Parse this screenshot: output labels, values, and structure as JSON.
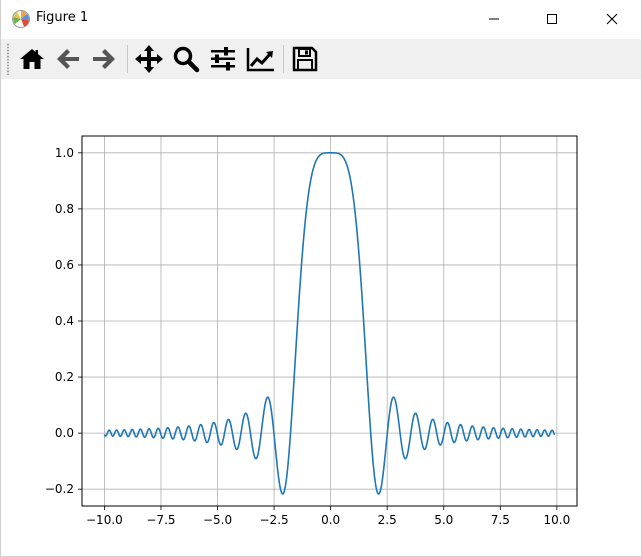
{
  "window": {
    "title": "Figure 1",
    "controls": {
      "minimize": "minimize",
      "maximize": "maximize",
      "close": "close"
    }
  },
  "toolbar": {
    "items": [
      {
        "name": "home",
        "icon": "home-icon"
      },
      {
        "name": "back",
        "icon": "arrow-left-icon"
      },
      {
        "name": "forward",
        "icon": "arrow-right-icon"
      },
      {
        "name": "pan",
        "icon": "move-icon"
      },
      {
        "name": "zoom",
        "icon": "magnifier-icon"
      },
      {
        "name": "subplots",
        "icon": "sliders-icon"
      },
      {
        "name": "edit-axes",
        "icon": "chart-line-icon"
      },
      {
        "name": "save",
        "icon": "floppy-icon"
      }
    ]
  },
  "chart_data": {
    "type": "line",
    "title": "",
    "xlabel": "",
    "ylabel": "",
    "function": "sin(x^2)/x^2 over [-10, 10)",
    "x": [
      -10.0,
      -9.5,
      -9.0,
      -8.5,
      -8.0,
      -7.5,
      -7.0,
      -6.5,
      -6.0,
      -5.5,
      -5.0,
      -4.5,
      -4.0,
      -3.5,
      -3.0,
      -2.75,
      -2.5,
      -2.25,
      -2.0,
      -1.75,
      -1.5,
      -1.25,
      -1.0,
      -0.75,
      -0.5,
      -0.25,
      0.0,
      0.25,
      0.5,
      0.75,
      1.0,
      1.25,
      1.5,
      1.75,
      2.0,
      2.25,
      2.5,
      2.75,
      3.0,
      3.5,
      4.0,
      4.5,
      5.0,
      5.5,
      6.0,
      6.5,
      7.0,
      7.5,
      8.0,
      8.5,
      9.0,
      9.5,
      9.9
    ],
    "y": [
      -0.005,
      0.009,
      -0.0078,
      0.0111,
      0.0144,
      -0.0066,
      -0.0195,
      0.0216,
      -0.028,
      0.0236,
      -0.0053,
      0.046,
      -0.018,
      -0.0251,
      0.0458,
      0.1238,
      -0.0053,
      -0.1847,
      -0.1892,
      -0.0259,
      0.3464,
      0.6454,
      0.8415,
      0.9714,
      0.9896,
      0.9993,
      1.0,
      0.9993,
      0.9896,
      0.9714,
      0.8415,
      0.6454,
      0.3464,
      -0.0259,
      -0.1892,
      -0.1847,
      -0.0053,
      0.1238,
      0.0458,
      -0.0251,
      -0.018,
      0.046,
      -0.0053,
      0.0236,
      -0.028,
      0.0216,
      -0.0195,
      -0.0066,
      0.0144,
      0.0111,
      -0.0078,
      0.009,
      -0.005
    ],
    "xlim": [
      -10.99,
      10.89
    ],
    "ylim": [
      -0.26,
      1.06
    ],
    "xticks": [
      -10.0,
      -7.5,
      -5.0,
      -2.5,
      0.0,
      2.5,
      5.0,
      7.5,
      10.0
    ],
    "xtick_labels": [
      "−10.0",
      "−7.5",
      "−5.0",
      "−2.5",
      "0.0",
      "2.5",
      "5.0",
      "7.5",
      "10.0"
    ],
    "yticks": [
      -0.2,
      0.0,
      0.2,
      0.4,
      0.6,
      0.8,
      1.0
    ],
    "ytick_labels": [
      "−0.2",
      "0.0",
      "0.2",
      "0.4",
      "0.6",
      "0.8",
      "1.0"
    ],
    "grid": true,
    "color": "#1f77b4",
    "grid_color": "#b0b0b0"
  }
}
